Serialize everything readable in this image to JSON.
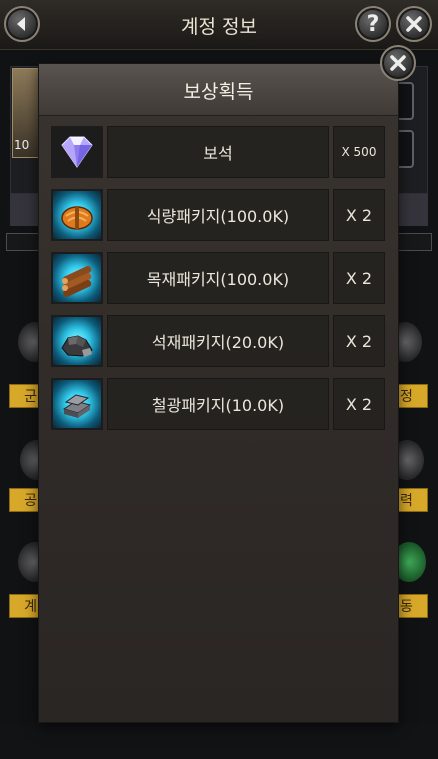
{
  "screen": {
    "title": "계정 정보",
    "help_label": "?",
    "level": "10"
  },
  "side_labels": {
    "left": [
      "군",
      "공",
      "계"
    ],
    "right": [
      "정",
      "력",
      "동"
    ]
  },
  "modal": {
    "title": "보상획득",
    "rewards": [
      {
        "icon": "gem-icon",
        "name": "보석",
        "qty": "X 500"
      },
      {
        "icon": "food-package-icon",
        "name": "식량패키지(100.0K)",
        "qty": "X 2"
      },
      {
        "icon": "wood-package-icon",
        "name": "목재패키지(100.0K)",
        "qty": "X 2"
      },
      {
        "icon": "stone-package-icon",
        "name": "석재패키지(20.0K)",
        "qty": "X 2"
      },
      {
        "icon": "iron-package-icon",
        "name": "철광패키지(10.0K)",
        "qty": "X 2"
      }
    ]
  },
  "colors": {
    "accent_gold": "#d8a82a",
    "glow_cyan": "#31c8ea",
    "modal_bg": "#3a3430"
  }
}
